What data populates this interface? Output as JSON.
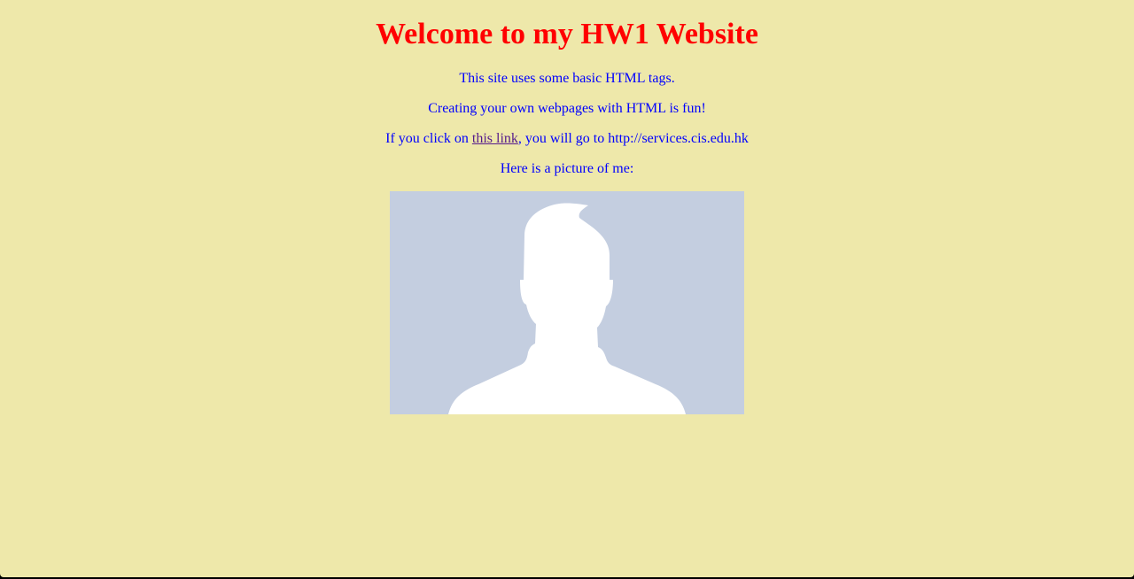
{
  "page": {
    "title": "Welcome to my HW1 Website",
    "line1": "This site uses some basic HTML tags.",
    "line2": "Creating your own webpages with HTML is fun!",
    "line3_prefix": "If you click on ",
    "line3_link": "this link",
    "line3_suffix": ", you will go to http://services.cis.edu.hk",
    "line4": "Here is a picture of me:"
  },
  "photo": {
    "icon": "default-profile-silhouette-icon",
    "background_color": "#C4CEE0"
  },
  "colors": {
    "page_background": "#EEE8AA",
    "title": "#FF0000",
    "body_text": "#0000FF",
    "link": "#551A8B"
  }
}
